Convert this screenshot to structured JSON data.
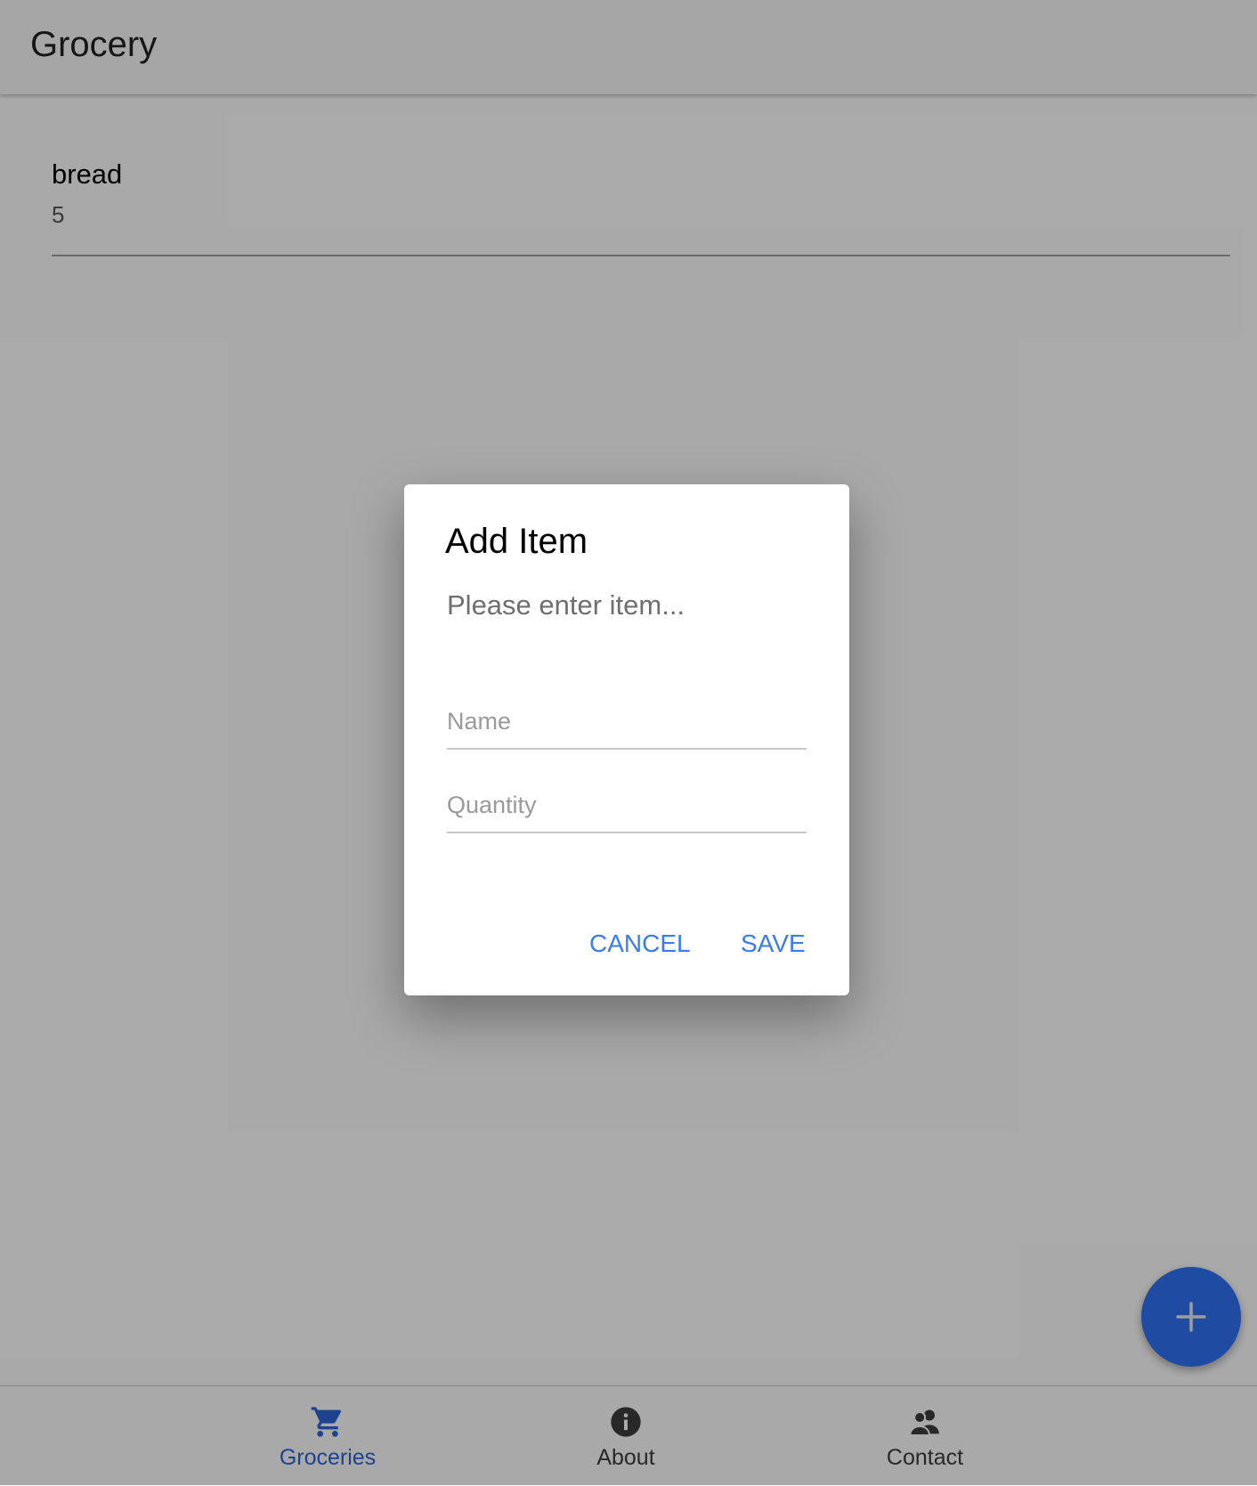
{
  "app": {
    "title": "Grocery"
  },
  "list": {
    "items": [
      {
        "name": "bread",
        "quantity": "5"
      }
    ]
  },
  "dialog": {
    "title": "Add Item",
    "message": "Please enter item...",
    "name_placeholder": "Name",
    "name_value": "",
    "quantity_placeholder": "Quantity",
    "quantity_value": "",
    "cancel_label": "CANCEL",
    "save_label": "SAVE"
  },
  "fab": {
    "icon": "plus-icon"
  },
  "bottom_nav": {
    "items": [
      {
        "label": "Groceries",
        "icon": "cart-icon",
        "active": true
      },
      {
        "label": "About",
        "icon": "info-icon",
        "active": false
      },
      {
        "label": "Contact",
        "icon": "people-icon",
        "active": false
      }
    ]
  },
  "colors": {
    "accent": "#2f6fef",
    "active_nav": "#2b63d3",
    "button_text": "#3b7bea"
  }
}
